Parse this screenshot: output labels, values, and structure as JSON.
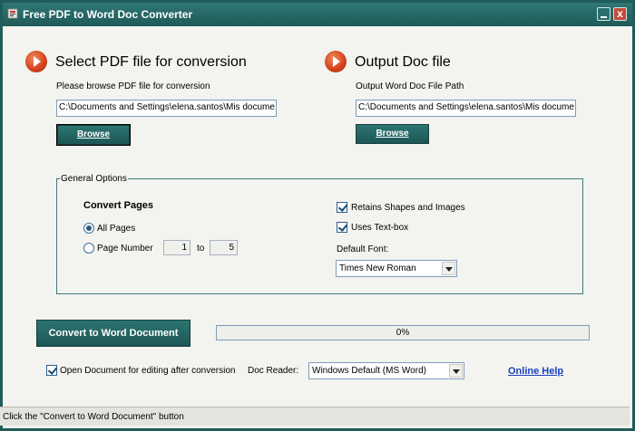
{
  "window": {
    "title": "Free PDF to Word Doc Converter",
    "close_glyph": "x"
  },
  "input_section": {
    "title": "Select PDF file for conversion",
    "hint": "Please browse PDF file for conversion",
    "path_value": "C:\\Documents and Settings\\elena.santos\\Mis docume",
    "browse_label": "Browse"
  },
  "output_section": {
    "title": "Output Doc file",
    "hint": "Output Word Doc File Path",
    "path_value": "C:\\Documents and Settings\\elena.santos\\Mis docume",
    "browse_label": "Browse"
  },
  "options": {
    "group_label": "General Options",
    "convert_pages_label": "Convert Pages",
    "all_pages_label": "All Pages",
    "all_pages_selected": true,
    "page_number_label": "Page Number",
    "page_from": "1",
    "to_label": "to",
    "page_to": "5",
    "retain_shapes_label": "Retains Shapes and Images",
    "retain_shapes_checked": true,
    "use_textbox_label": "Uses Text-box",
    "use_textbox_checked": true,
    "default_font_label": "Default Font:",
    "default_font_value": "Times New Roman"
  },
  "actions": {
    "convert_label": "Convert to Word Document",
    "progress_percent": 0,
    "progress_text": "0%",
    "open_after_label": "Open Document for editing after conversion",
    "open_after_checked": true,
    "doc_reader_label": "Doc Reader:",
    "doc_reader_value": "Windows Default (MS Word)",
    "online_help_label": "Online Help"
  },
  "status": {
    "text": "Click the \"Convert to Word Document\" button"
  },
  "colors": {
    "accent": "#1f5c5a",
    "button": "#2c7572",
    "link": "#1a3fbf",
    "icon": "#d1401a"
  }
}
